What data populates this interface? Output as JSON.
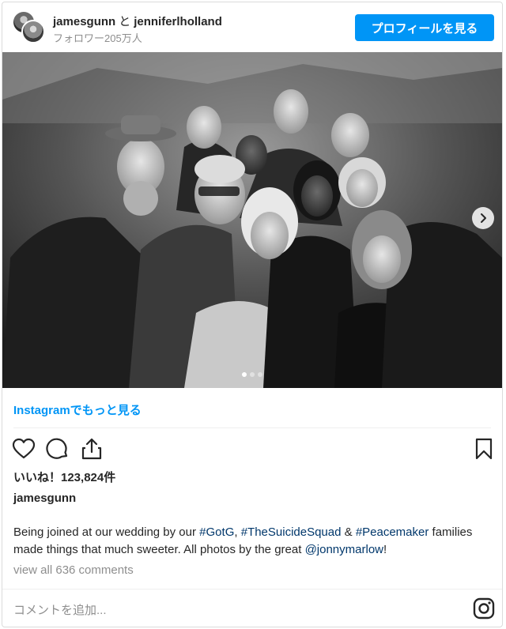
{
  "header": {
    "author1": "jamesgunn",
    "conjunction": "と",
    "author2": "jenniferlholland",
    "followers": "フォロワー205万人",
    "profile_button": "プロフィールを見る"
  },
  "photo": {
    "alt": "Group photo of wedding guests, black and white",
    "dots": 3,
    "active_dot": 1
  },
  "more_link": "Instagramでもっと見る",
  "actions": {
    "like_icon": "heart-icon",
    "comment_icon": "comment-icon",
    "share_icon": "share-icon",
    "save_icon": "bookmark-icon"
  },
  "likes": "いいね！123,824件",
  "post_author": "jamesgunn",
  "caption": {
    "part1": "Being joined at our wedding by our ",
    "tag1": "#GotG",
    "sep1": ", ",
    "tag2": "#TheSuicideSquad",
    "sep2": " & ",
    "tag3": "#Peacemaker",
    "part2": " families made things that much sweeter. All photos by the great ",
    "mention": "@jonnymarlow",
    "part3": "!"
  },
  "view_all": "view all 636 comments",
  "comment_placeholder": "コメントを追加...",
  "colors": {
    "accent": "#0095f6",
    "link": "#00376b",
    "muted": "#8e8e8e"
  }
}
